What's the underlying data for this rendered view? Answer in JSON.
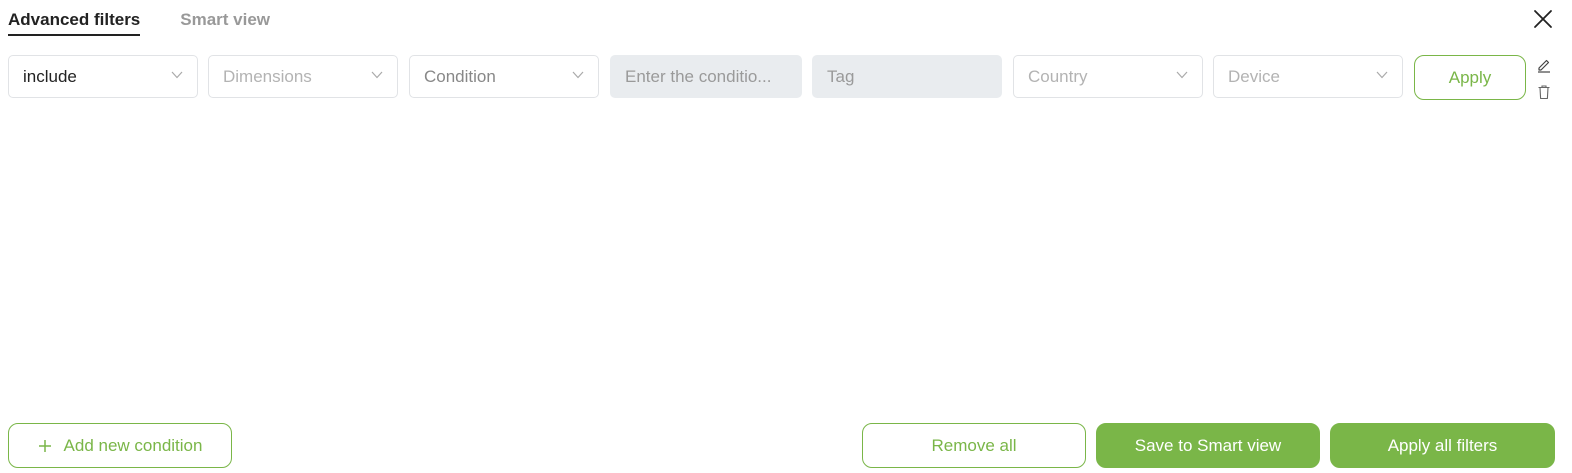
{
  "tabs": [
    {
      "label": "Advanced filters",
      "active": true
    },
    {
      "label": "Smart view",
      "active": false
    }
  ],
  "filter_row": {
    "include": "include",
    "dimensions_placeholder": "Dimensions",
    "condition_placeholder": "Condition",
    "condition_value_placeholder": "Enter the conditio...",
    "tag_placeholder": "Tag",
    "country_placeholder": "Country",
    "device_placeholder": "Device",
    "apply_label": "Apply"
  },
  "footer": {
    "add_condition_label": "Add new condition",
    "remove_all_label": "Remove all",
    "save_smart_view_label": "Save to Smart view",
    "apply_all_label": "Apply all filters"
  },
  "colors": {
    "accent": "#7ab648",
    "disabled_bg": "#e9ecef",
    "border": "#e1e3e6"
  },
  "icons": [
    "close-icon",
    "chevron-down-icon",
    "edit-icon",
    "trash-icon",
    "plus-icon"
  ]
}
